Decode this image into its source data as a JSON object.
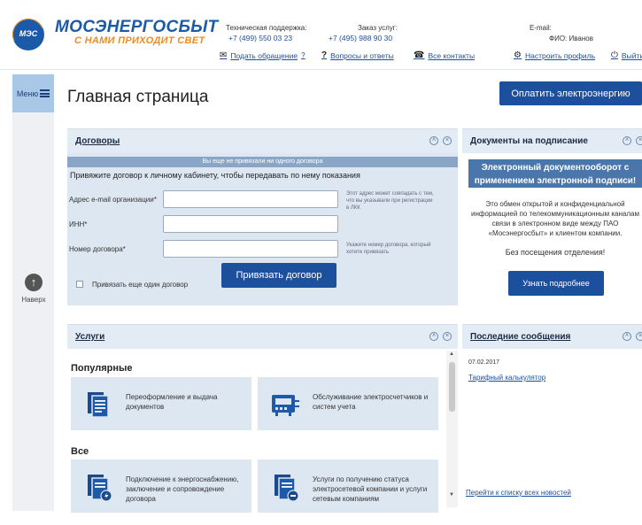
{
  "header": {
    "logo_text": "МЭС",
    "brand": "МОСЭНЕРГОСБЫТ",
    "slogan": "С НАМИ ПРИХОДИТ СВЕТ",
    "support_label": "Техническая поддержка:",
    "support_phone": "+7 (499) 550 03 23",
    "order_label": "Заказ услуг:",
    "order_phone": "+7 (495) 988 90 30",
    "email_label": "E-mail:",
    "fio_label": "ФИО: Иванов",
    "links": {
      "submit": "Подать обращение",
      "faq": "Вопросы и ответы",
      "contacts": "Все контакты",
      "profile": "Настроить профиль",
      "logout": "Выйти"
    }
  },
  "sidebar": {
    "menu_label": "Меню",
    "up_label": "Наверх"
  },
  "page": {
    "title": "Главная страница",
    "pay_button": "Оплатить электроэнергию"
  },
  "contracts": {
    "title": "Договоры",
    "banner": "Вы еще не привязали ни одного договора",
    "intro": "Привяжите договор к личному кабинету, чтобы передавать по нему показания",
    "email_label": "Адрес e-mail организации*",
    "email_hint": "Этот адрес может совпадать с тем, что вы указывали при регистрации в ЛКК",
    "inn_label": "ИНН*",
    "number_label": "Номер договора*",
    "number_hint": "Укажите номер договора, который хотите привязать",
    "bind_button": "Привязать договор",
    "another_label": "Привязать еще один договор"
  },
  "docs": {
    "title": "Документы на подписание",
    "banner": "Электронный документооборот с применением электронной подписи!",
    "desc": "Это обмен открытой и конфиденциальной информацией по телекоммуникационным каналам связи в электронном виде между ПАО «Мосэнергосбыт» и клиентом компании.",
    "no_visit": "Без посещения отделения!",
    "more_button": "Узнать подробнее"
  },
  "services": {
    "title": "Услуги",
    "popular_label": "Популярные",
    "all_label": "Все",
    "tiles": [
      {
        "text": "Переоформление и выдача документов",
        "icon": "document-icon"
      },
      {
        "text": "Обслуживание электросчетчиков и систем учета",
        "icon": "meter-icon"
      },
      {
        "text": "Подключение к энергоснабжению, заключение и сопровождение договора",
        "icon": "document-lightning-icon"
      },
      {
        "text": "Услуги по получению статуса электросетевой компании и услуги сетевым компаниям",
        "icon": "document-badge-icon"
      }
    ]
  },
  "news": {
    "title": "Последние сообщения",
    "date": "07.02.2017",
    "item": "Тарифный калькулятор",
    "all_link": "Перейти к списку всех новостей"
  },
  "colors": {
    "brand_blue": "#1c4f9c",
    "brand_orange": "#f08a1c",
    "panel_bg": "#e3ebf4"
  }
}
